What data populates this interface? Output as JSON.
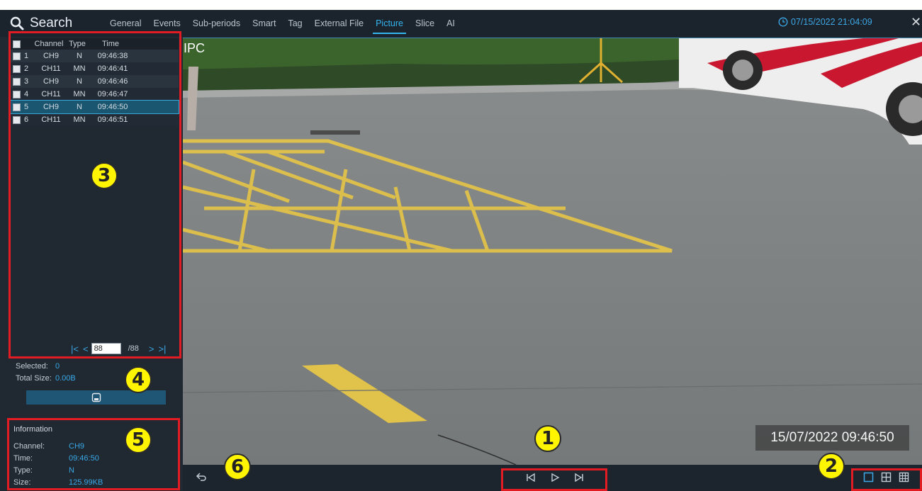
{
  "header": {
    "title": "Search",
    "tabs": [
      "General",
      "Events",
      "Sub-periods",
      "Smart",
      "Tag",
      "External File",
      "Picture",
      "Slice",
      "AI"
    ],
    "active_tab": "Picture",
    "datetime": "07/15/2022 21:04:09"
  },
  "table": {
    "headers": {
      "channel": "Channel",
      "type": "Type",
      "time": "Time"
    },
    "rows": [
      {
        "idx": "1",
        "channel": "CH9",
        "type": "N",
        "time": "09:46:38"
      },
      {
        "idx": "2",
        "channel": "CH11",
        "type": "MN",
        "time": "09:46:41"
      },
      {
        "idx": "3",
        "channel": "CH9",
        "type": "N",
        "time": "09:46:46"
      },
      {
        "idx": "4",
        "channel": "CH11",
        "type": "MN",
        "time": "09:46:47"
      },
      {
        "idx": "5",
        "channel": "CH9",
        "type": "N",
        "time": "09:46:50"
      },
      {
        "idx": "6",
        "channel": "CH11",
        "type": "MN",
        "time": "09:46:51"
      }
    ],
    "selected_row": 5
  },
  "pager": {
    "current": "88",
    "total": "/88"
  },
  "selection": {
    "selected_label": "Selected:",
    "selected_value": "0",
    "size_label": "Total Size:",
    "size_value": "0.00B"
  },
  "info": {
    "title": "Information",
    "channel_label": "Channel:",
    "channel": "CH9",
    "time_label": "Time:",
    "time": "09:46:50",
    "type_label": "Type:",
    "type": "N",
    "size_label": "Size:",
    "size": "125.99KB"
  },
  "video": {
    "overlay_label": "IPC",
    "timestamp": "15/07/2022 09:46:50"
  },
  "callouts": [
    "1",
    "2",
    "3",
    "4",
    "5",
    "6"
  ],
  "colors": {
    "accent": "#34b6ef",
    "callout_fill": "#fff500",
    "highlight_border": "#e31b22"
  }
}
